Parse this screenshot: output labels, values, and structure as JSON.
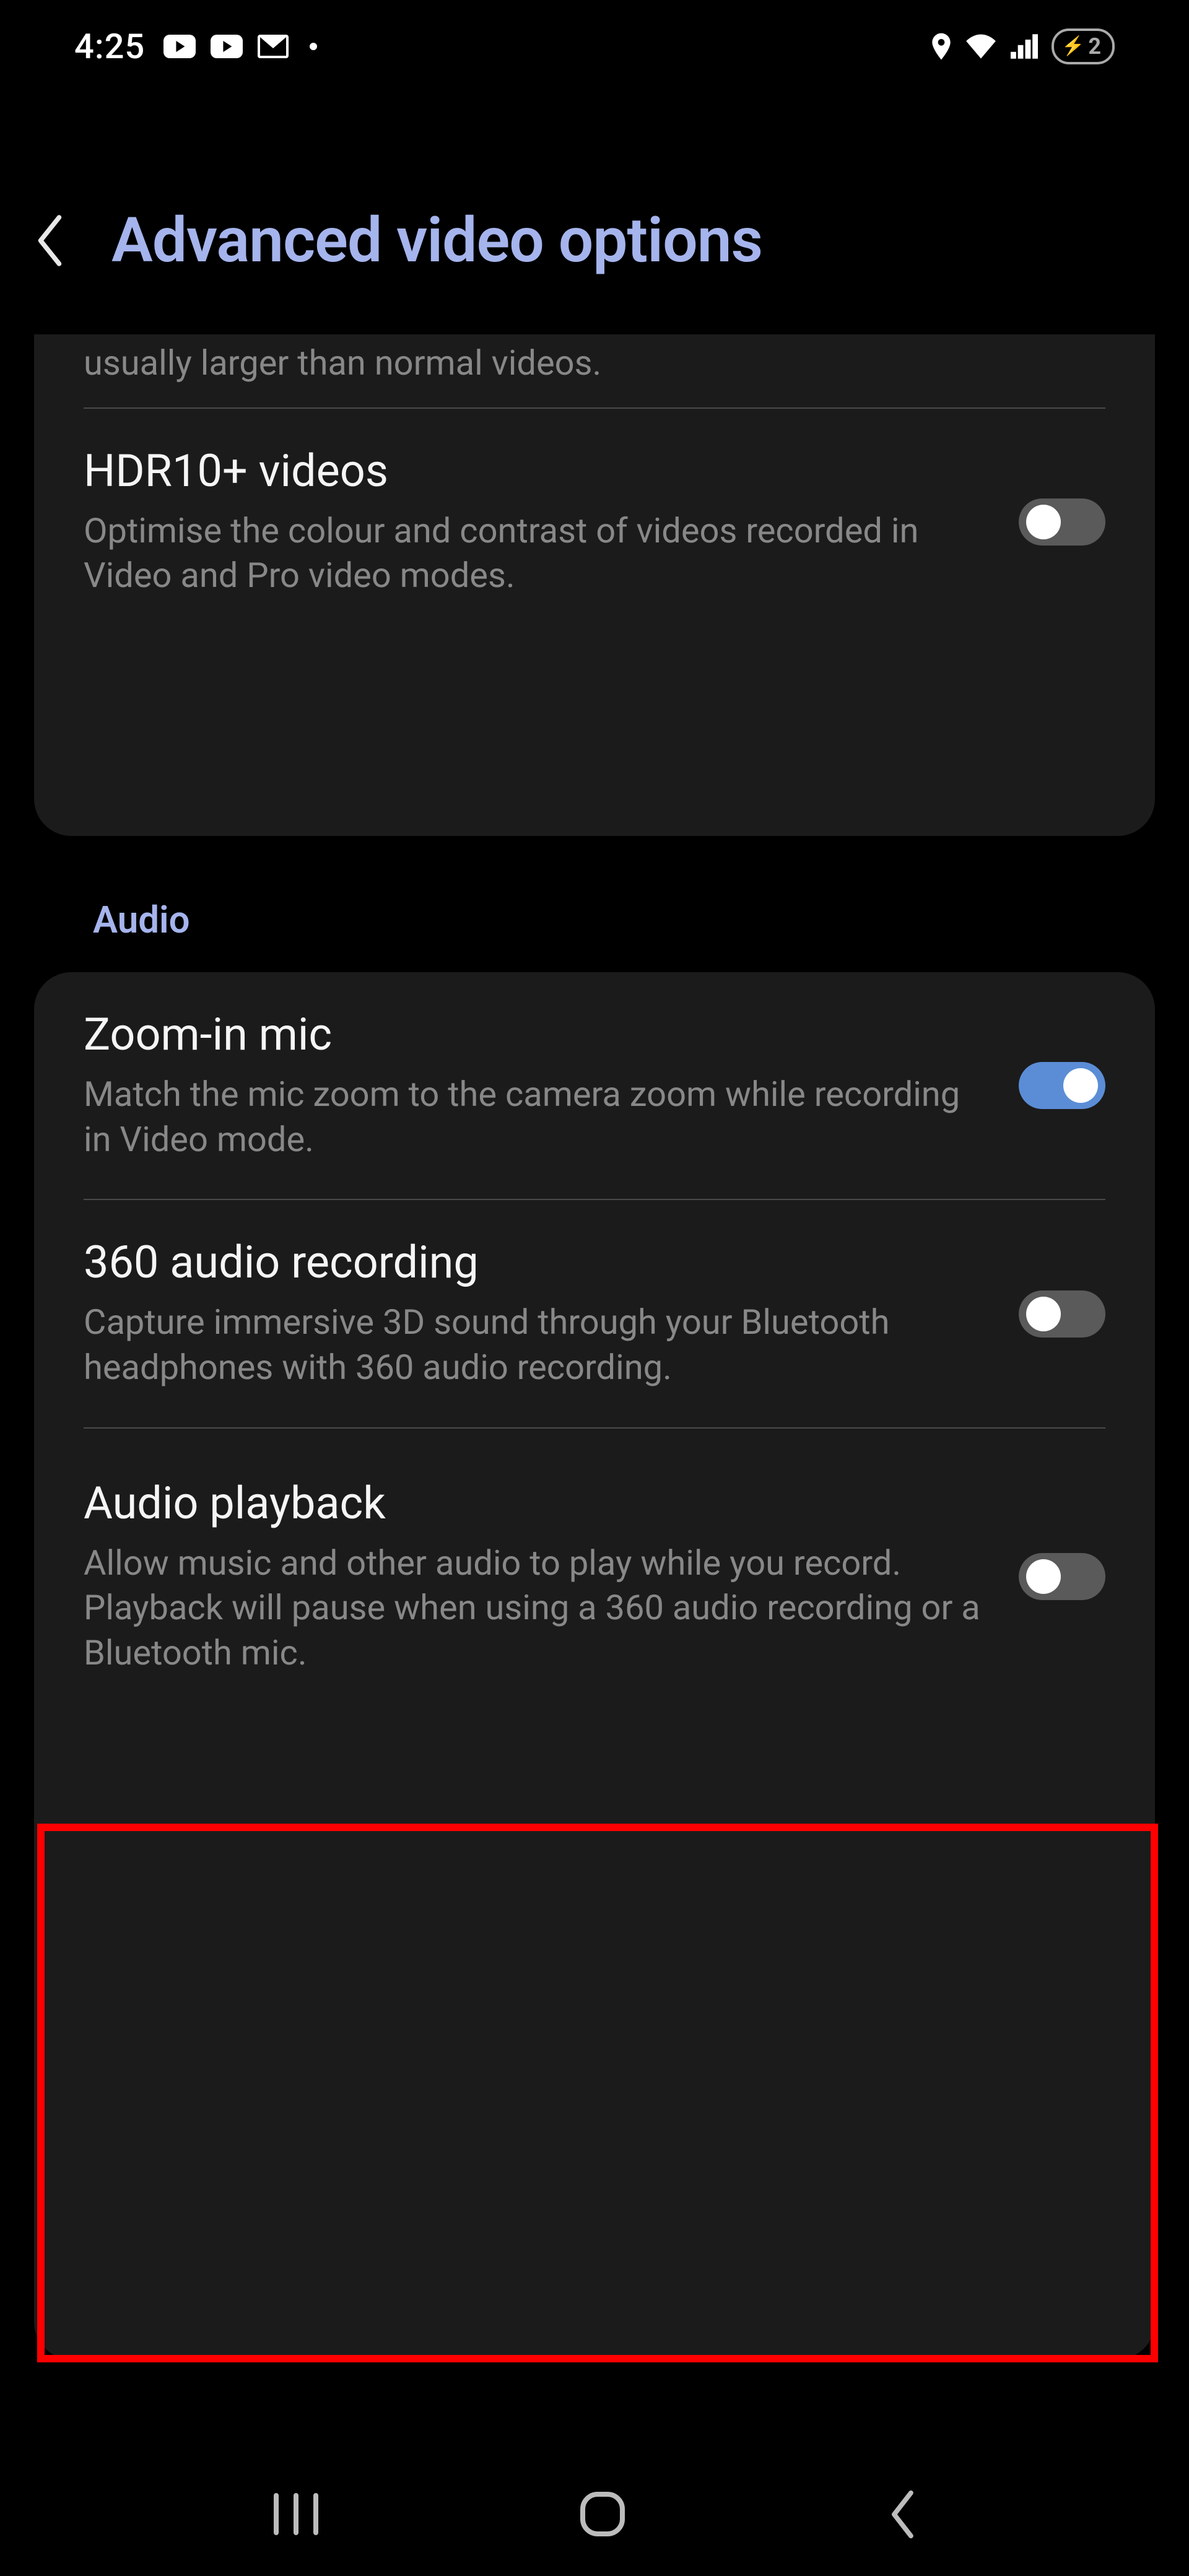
{
  "status": {
    "time": "4:25",
    "battery": "2"
  },
  "header": {
    "title": "Advanced video options"
  },
  "clipped_desc": "usually larger than normal videos.",
  "video_items": [
    {
      "title": "HDR10+ videos",
      "desc": "Optimise the colour and contrast of videos recorded in Video and Pro video modes.",
      "on": false
    }
  ],
  "audio_label": "Audio",
  "audio_items": [
    {
      "title": "Zoom-in mic",
      "desc": "Match the mic zoom to the camera zoom while recording in Video mode.",
      "on": true
    },
    {
      "title": "360 audio recording",
      "desc": "Capture immersive 3D sound through your Bluetooth headphones with 360 audio recording.",
      "on": false
    },
    {
      "title": "Audio playback",
      "desc": "Allow music and other audio to play while you record. Playback will pause when using a 360 audio recording or a Bluetooth mic.",
      "on": false
    }
  ]
}
